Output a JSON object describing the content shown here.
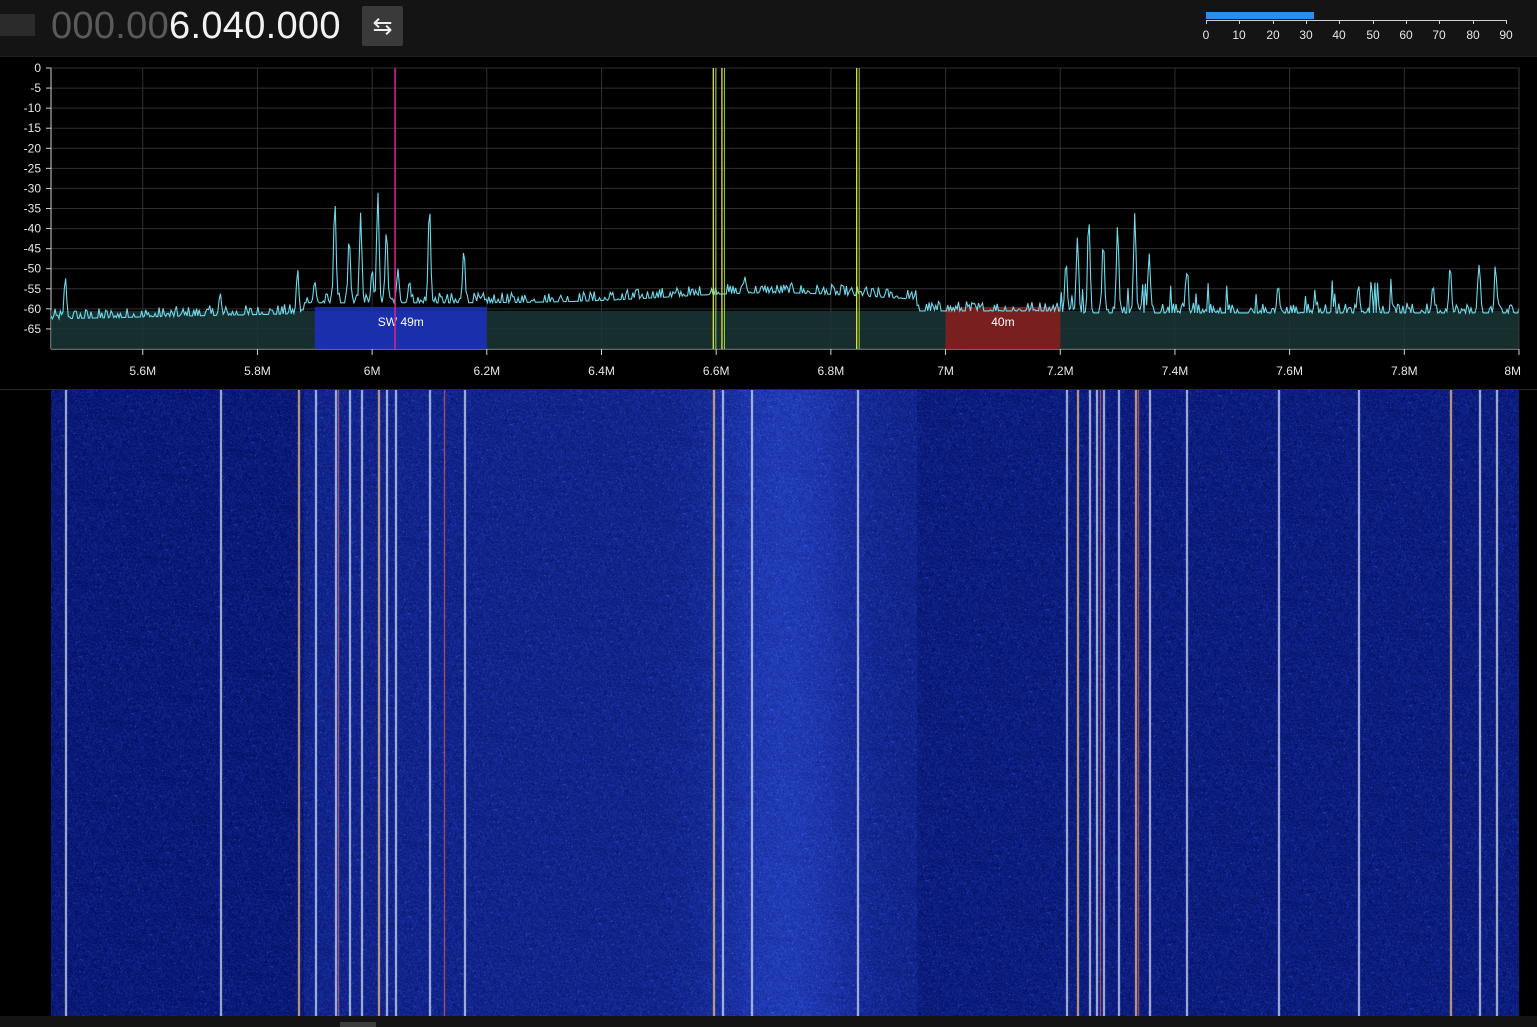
{
  "header": {
    "frequency_dim": "000.00",
    "frequency_main": "6.040.000",
    "swap_icon_glyph": "⇆",
    "swap_icon": "swap-arrows-icon"
  },
  "snr_meter": {
    "ticks": [
      "0",
      "10",
      "20",
      "30",
      "40",
      "50",
      "60",
      "70",
      "80",
      "90"
    ],
    "level": 32,
    "max": 90,
    "fill_color": "#2b8fe8"
  },
  "spectrum": {
    "y_ticks": [
      "0",
      "-5",
      "-10",
      "-15",
      "-20",
      "-25",
      "-30",
      "-35",
      "-40",
      "-45",
      "-50",
      "-55",
      "-60",
      "-65"
    ],
    "y_values": [
      0,
      -5,
      -10,
      -15,
      -20,
      -25,
      -30,
      -35,
      -40,
      -45,
      -50,
      -55,
      -60,
      -65
    ],
    "y_range": [
      -70,
      0
    ],
    "x_ticks": [
      "5.6M",
      "5.8M",
      "6M",
      "6.2M",
      "6.4M",
      "6.6M",
      "6.8M",
      "7M",
      "7.2M",
      "7.4M",
      "7.6M",
      "7.8M",
      "8M"
    ],
    "x_values": [
      5.6,
      5.8,
      6.0,
      6.2,
      6.4,
      6.6,
      6.8,
      7.0,
      7.2,
      7.4,
      7.6,
      7.8,
      8.0
    ],
    "x_range_mhz": [
      5.44,
      8.0
    ],
    "trace_color": "#6fd8ea",
    "bands": [
      {
        "label": "SW 49m",
        "start_mhz": 5.9,
        "end_mhz": 6.2,
        "color": "#1a2fc2"
      },
      {
        "label": "40m",
        "start_mhz": 7.0,
        "end_mhz": 7.2,
        "color": "#8b1c1c"
      }
    ],
    "tuned_marker_mhz": 6.04,
    "tuned_marker_color": "#e0208f",
    "bookmarks_mhz": [
      6.595,
      6.61,
      6.845
    ],
    "bookmark_color": "#e4e23a"
  }
}
